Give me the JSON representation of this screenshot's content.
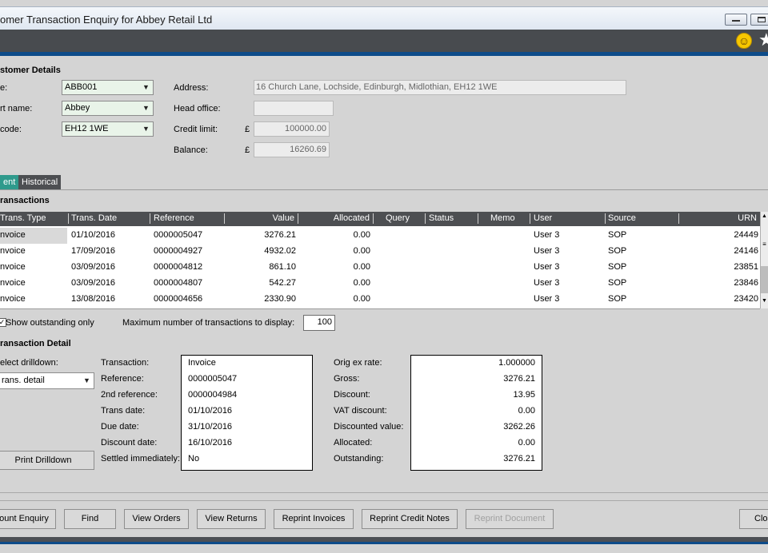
{
  "window": {
    "title": "omer Transaction Enquiry for Abbey Retail Ltd"
  },
  "customer": {
    "section_title": "stomer Details",
    "code_label": "e:",
    "code_value": "ABB001",
    "short_name_label": "rt name:",
    "short_name_value": "Abbey",
    "postcode_label": "code:",
    "postcode_value": "EH12 1WE",
    "address_label": "Address:",
    "address_value": "16 Church Lane, Lochside, Edinburgh, Midlothian, EH12 1WE",
    "head_office_label": "Head office:",
    "head_office_value": "",
    "credit_limit_label": "Credit limit:",
    "currency_symbol": "£",
    "credit_limit_value": "100000.00",
    "balance_label": "Balance:",
    "balance_value": "16260.69"
  },
  "tabs": [
    {
      "label": "ent",
      "active": true
    },
    {
      "label": "Historical",
      "active": false
    }
  ],
  "transactions": {
    "section_title": "ransactions",
    "columns": [
      "Trans. Type",
      "Trans. Date",
      "Reference",
      "Value",
      "Allocated",
      "Query",
      "Status",
      "Memo",
      "User",
      "Source",
      "URN"
    ],
    "rows": [
      [
        "nvoice",
        "01/10/2016",
        "0000005047",
        "3276.21",
        "0.00",
        "",
        "",
        "",
        "User 3",
        "SOP",
        "24449"
      ],
      [
        "nvoice",
        "17/09/2016",
        "0000004927",
        "4932.02",
        "0.00",
        "",
        "",
        "",
        "User 3",
        "SOP",
        "24146"
      ],
      [
        "nvoice",
        "03/09/2016",
        "0000004812",
        "861.10",
        "0.00",
        "",
        "",
        "",
        "User 3",
        "SOP",
        "23851"
      ],
      [
        "nvoice",
        "03/09/2016",
        "0000004807",
        "542.27",
        "0.00",
        "",
        "",
        "",
        "User 3",
        "SOP",
        "23846"
      ],
      [
        "nvoice",
        "13/08/2016",
        "0000004656",
        "2330.90",
        "0.00",
        "",
        "",
        "",
        "User 3",
        "SOP",
        "23420"
      ]
    ],
    "show_outstanding_label": "Show outstanding only",
    "show_outstanding_checked": true,
    "max_label": "Maximum number of transactions to display:",
    "max_value": "100"
  },
  "detail": {
    "section_title": "ransaction Detail",
    "drilldown_label": "elect drilldown:",
    "drilldown_value": "rans. detail",
    "print_button": "Print Drilldown",
    "left_labels": [
      "Transaction:",
      "Reference:",
      "2nd reference:",
      "Trans date:",
      "Due date:",
      "Discount date:",
      "Settled immediately:"
    ],
    "left_values": [
      "Invoice",
      "0000005047",
      "0000004984",
      "01/10/2016",
      "31/10/2016",
      "16/10/2016",
      "No"
    ],
    "right_labels": [
      "Orig ex rate:",
      "Gross:",
      "Discount:",
      "VAT discount:",
      "Discounted value:",
      "Allocated:",
      "Outstanding:"
    ],
    "right_values": [
      "1.000000",
      "3276.21",
      "13.95",
      "0.00",
      "3262.26",
      "0.00",
      "3276.21"
    ]
  },
  "buttons": {
    "account_enquiry": "ount Enquiry",
    "find": "Find",
    "view_orders": "View Orders",
    "view_returns": "View Returns",
    "reprint_invoices": "Reprint Invoices",
    "reprint_credit_notes": "Reprint Credit Notes",
    "reprint_document": "Reprint Document",
    "close": "Clos"
  },
  "icons": {
    "toolbar": [
      "smiley-icon",
      "star-icon"
    ]
  },
  "colors": {
    "accent_blue": "#0e4c8a",
    "active_tab": "#2f9a8c",
    "header_dark": "#4d4f52"
  }
}
